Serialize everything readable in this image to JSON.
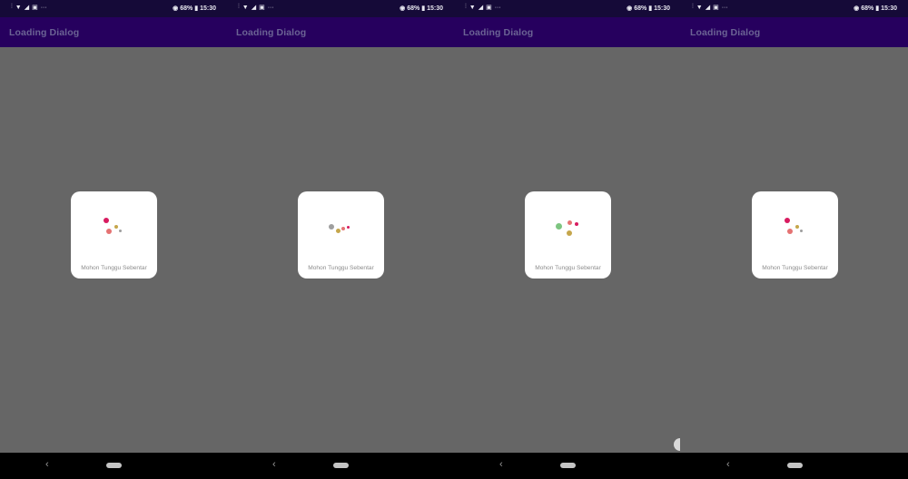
{
  "status_bar": {
    "left_icons": [
      "vibrate-icon",
      "wifi-icon",
      "signal-icon",
      "gallery-icon",
      "more-icon"
    ],
    "right_icons": [
      "eye-icon",
      "battery-icon"
    ],
    "battery": "68%",
    "time": "15:30"
  },
  "app_bar": {
    "title": "Loading Dialog"
  },
  "dialog": {
    "message": "Mohon Tunggu Sebentar",
    "loader_icon": "bouncing-dots-icon",
    "colors": [
      "#d81b60",
      "#e57373",
      "#c5a64b",
      "#9e9e9e",
      "#66bb6a"
    ]
  },
  "nav_bar": {
    "icons": [
      "back-icon",
      "home-pill-icon"
    ]
  },
  "colors": {
    "status_bar": "#150a38",
    "app_bar": "#26005e",
    "title_text": "#6b6394",
    "scrim": "#666666",
    "nav_bar": "#000000"
  }
}
